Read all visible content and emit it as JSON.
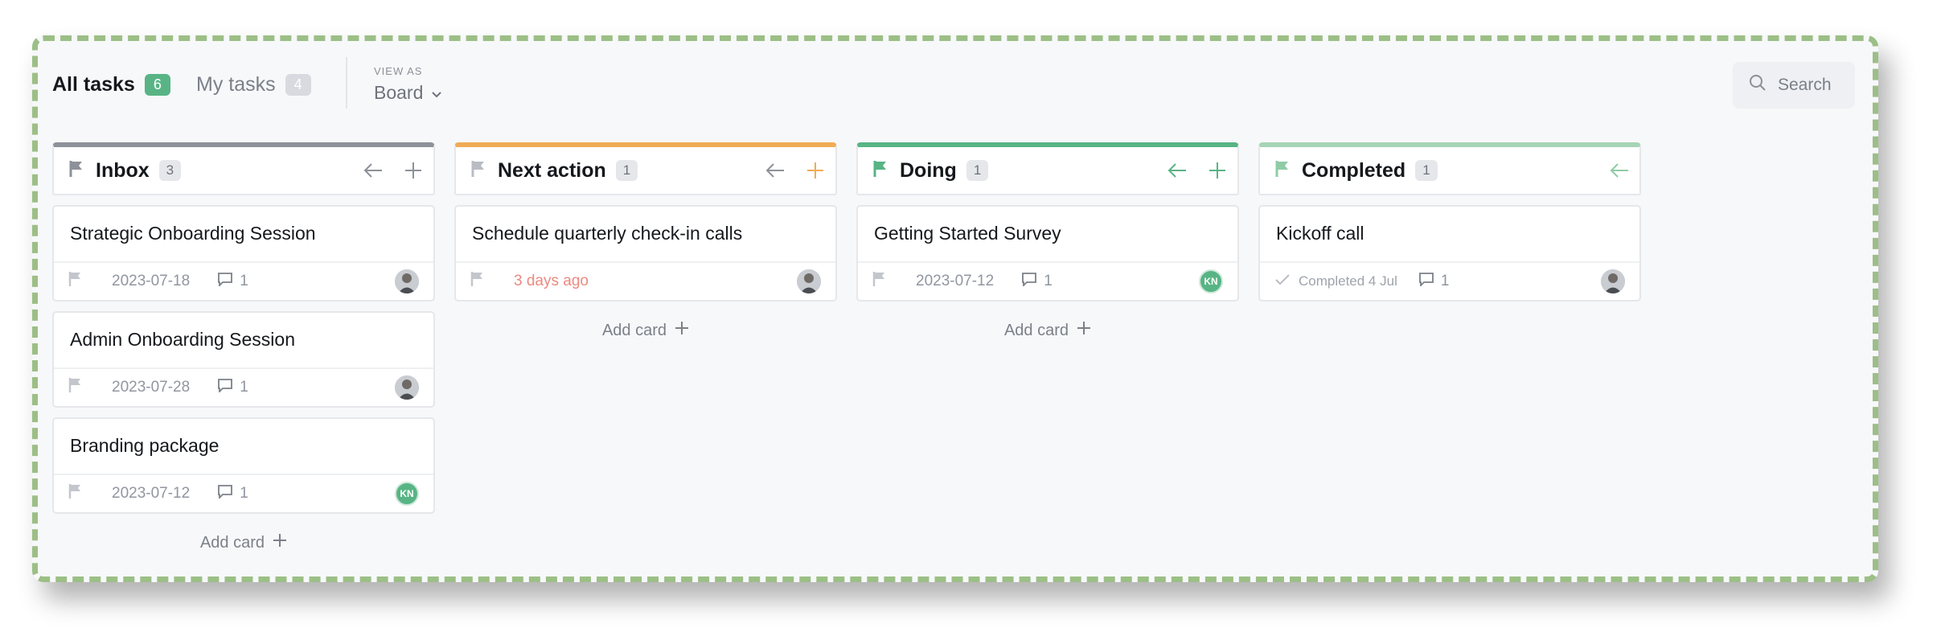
{
  "header": {
    "tabs": [
      {
        "label": "All tasks",
        "count": "6"
      },
      {
        "label": "My tasks",
        "count": "4"
      }
    ],
    "view_as_label": "VIEW AS",
    "view_as_value": "Board",
    "search_label": "Search"
  },
  "columns": [
    {
      "title": "Inbox",
      "count": "3",
      "accent": "#8d9199",
      "cards": [
        {
          "title": "Strategic Onboarding Session",
          "date": "2023-07-18",
          "comments": "1",
          "assignee": "photo"
        },
        {
          "title": "Admin Onboarding Session",
          "date": "2023-07-28",
          "comments": "1",
          "assignee": "photo"
        },
        {
          "title": "Branding package",
          "date": "2023-07-12",
          "comments": "1",
          "assignee": "KN"
        }
      ],
      "add_card": "Add card"
    },
    {
      "title": "Next action",
      "count": "1",
      "accent": "#f0ac55",
      "cards": [
        {
          "title": "Schedule quarterly check-in calls",
          "due": "3 days ago",
          "assignee": "photo"
        }
      ],
      "add_card": "Add card"
    },
    {
      "title": "Doing",
      "count": "1",
      "accent": "#58b485",
      "cards": [
        {
          "title": "Getting Started Survey",
          "date": "2023-07-12",
          "comments": "1",
          "assignee": "KN"
        }
      ],
      "add_card": "Add card"
    },
    {
      "title": "Completed",
      "count": "1",
      "accent": "#a6d4b6",
      "cards": [
        {
          "title": "Kickoff call",
          "completed": "Completed 4 Jul",
          "comments": "1",
          "assignee": "photo"
        }
      ]
    }
  ],
  "colors": {
    "brand_green": "#58b485",
    "frame_dash": "#9cbf86",
    "overdue": "#ea8a80"
  },
  "avatar_initials": "KN"
}
